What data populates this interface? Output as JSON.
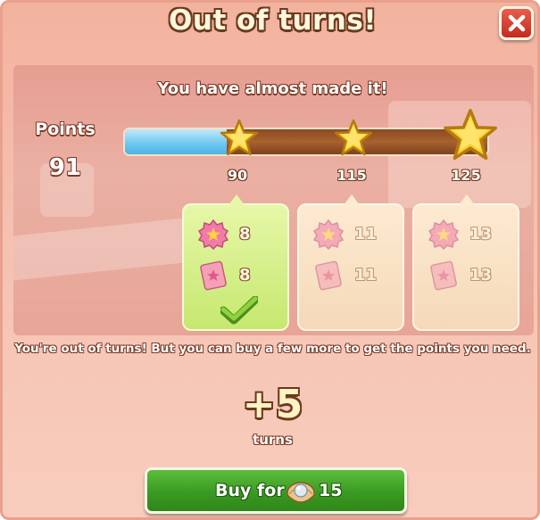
{
  "dialog": {
    "title": "Out of turns!",
    "subtitle": "You have almost made it!",
    "close_icon": "close-icon"
  },
  "progress": {
    "label": "Points",
    "current_points": "91",
    "milestones": [
      "90",
      "115",
      "125"
    ],
    "fill_fraction": 0.28,
    "fill_color": "#6cc6ee"
  },
  "rewards": [
    {
      "badge_count": "8",
      "ticket_count": "8",
      "achieved": true
    },
    {
      "badge_count": "11",
      "ticket_count": "11",
      "achieved": false
    },
    {
      "badge_count": "13",
      "ticket_count": "13",
      "achieved": false
    }
  ],
  "message": "You're out of turns! But you can buy a few more to get the points you need.",
  "offer": {
    "turns_amount": "+5",
    "turns_label": "turns",
    "buy_label": "Buy for",
    "price": "15",
    "currency_icon": "pearl-icon"
  },
  "colors": {
    "buy_button": "#3a9b22",
    "close_button": "#c42a1d",
    "achieved_card": "#c6e86f",
    "locked_card": "#f5d9b8"
  }
}
